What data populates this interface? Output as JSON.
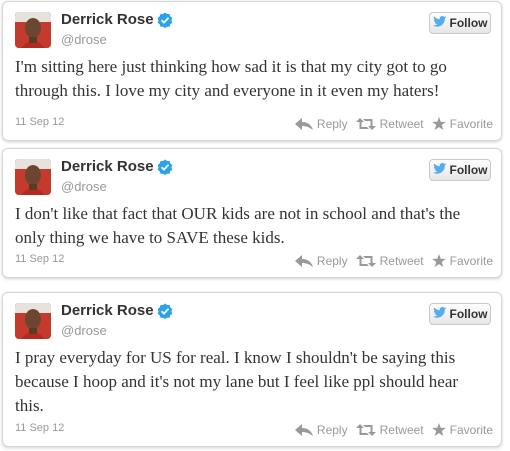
{
  "tweets": [
    {
      "name": "Derrick Rose",
      "handle": "@drose",
      "follow_label": "Follow",
      "text": "I'm sitting here just thinking how sad it is that my city got to go through this. I love my city and everyone in it even my haters!",
      "date": "11 Sep 12",
      "reply_label": "Reply",
      "retweet_label": "Retweet",
      "favorite_label": "Favorite"
    },
    {
      "name": "Derrick Rose",
      "handle": "@drose",
      "follow_label": "Follow",
      "text": "I don't like that fact that OUR kids are not in school and that's the only thing we have to SAVE these kids.",
      "date": "11 Sep 12",
      "reply_label": "Reply",
      "retweet_label": "Retweet",
      "favorite_label": "Favorite"
    },
    {
      "name": "Derrick Rose",
      "handle": "@drose",
      "follow_label": "Follow",
      "text": "I pray everyday for US for real. I know I shouldn't be saying this because I hoop and it's not my lane but I feel like ppl should hear this.",
      "date": "11 Sep 12",
      "reply_label": "Reply",
      "retweet_label": "Retweet",
      "favorite_label": "Favorite"
    }
  ],
  "icons": {
    "verified": "verified-badge-icon",
    "bird": "twitter-bird-icon",
    "reply": "reply-arrow-icon",
    "retweet": "retweet-icon",
    "favorite": "star-icon"
  },
  "colors": {
    "verified": "#2aa3ef",
    "bird": "#55acee",
    "text": "#333333",
    "muted": "#999999",
    "border": "#d6d6d6"
  }
}
